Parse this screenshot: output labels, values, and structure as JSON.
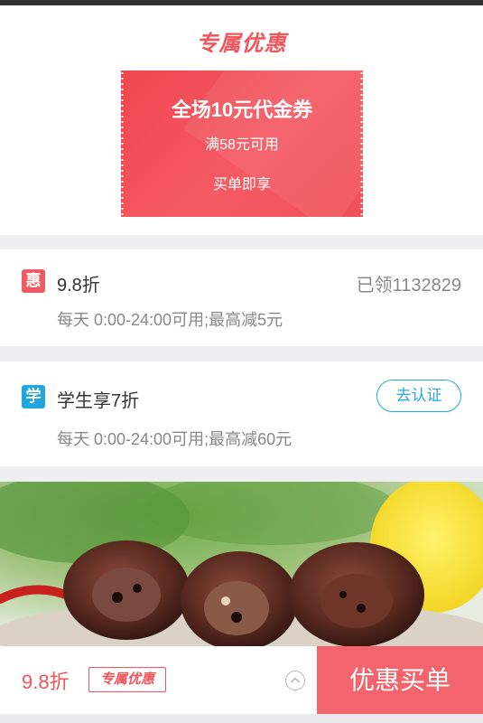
{
  "exclusive": {
    "title": "专属优惠",
    "coupon": {
      "main": "全场10元代金券",
      "condition": "满58元可用",
      "note": "买单即享"
    }
  },
  "discounts": [
    {
      "badge": "惠",
      "badge_color": "#f15a62",
      "name": "9.8折",
      "claimed": "已领1132829",
      "desc": "每天 0:00-24:00可用;最高减5元"
    },
    {
      "badge": "学",
      "badge_color": "#21a6e0",
      "name": "学生享7折",
      "action": "去认证",
      "desc": "每天 0:00-24:00可用;最高减60元"
    }
  ],
  "bottom": {
    "price": "9.8折",
    "tag": "专属优惠",
    "pay_label": "优惠买单",
    "expand_icon": "chevron-up-icon"
  }
}
